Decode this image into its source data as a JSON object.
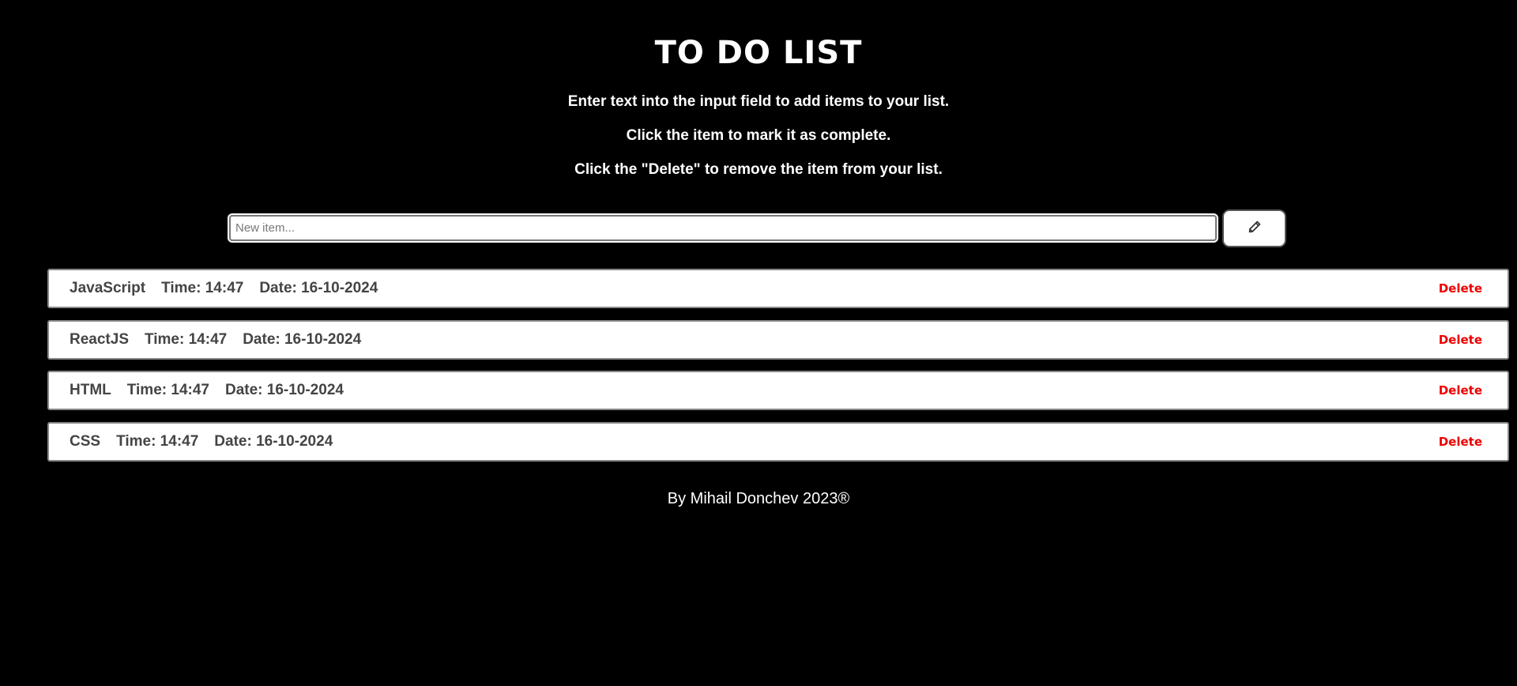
{
  "header": {
    "title": "TO DO LIST",
    "instructions": [
      "Enter text into the input field to add items to your list.",
      "Click the item to mark it as complete.",
      "Click the \"Delete\" to remove the item from your list."
    ]
  },
  "form": {
    "input_value": "",
    "input_placeholder": "New item...",
    "add_button_icon": "pencil-icon"
  },
  "items": [
    {
      "text": "JavaScript",
      "time": "Time: 14:47",
      "date": "Date: 16-10-2024",
      "delete_label": "Delete"
    },
    {
      "text": "ReactJS",
      "time": "Time: 14:47",
      "date": "Date: 16-10-2024",
      "delete_label": "Delete"
    },
    {
      "text": "HTML",
      "time": "Time: 14:47",
      "date": "Date: 16-10-2024",
      "delete_label": "Delete"
    },
    {
      "text": "CSS",
      "time": "Time: 14:47",
      "date": "Date: 16-10-2024",
      "delete_label": "Delete"
    }
  ],
  "footer": {
    "text": "By Mihail Donchev 2023®"
  },
  "colors": {
    "background": "#000000",
    "delete": "#ee0000",
    "item_text": "#444444"
  }
}
